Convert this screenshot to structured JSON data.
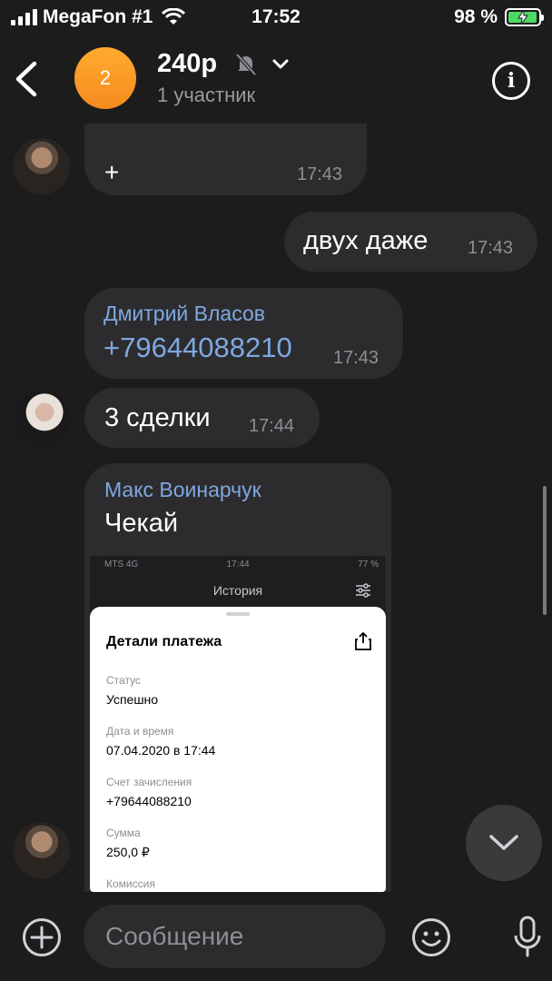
{
  "status_bar": {
    "carrier": "MegaFon #1",
    "time": "17:52",
    "battery": "98 %"
  },
  "header": {
    "avatar_letter": "2",
    "title": "240р",
    "subtitle": "1 участник",
    "info_label": "i"
  },
  "messages": [
    {
      "id": "m1",
      "sender": "",
      "text": "+",
      "time": "17:43",
      "outgoing": false
    },
    {
      "id": "m2",
      "text": "двух даже",
      "time": "17:43",
      "outgoing": true
    },
    {
      "id": "m3",
      "sender": "Дмитрий Власов",
      "text": "+79644088210",
      "time": "17:43",
      "outgoing": false
    },
    {
      "id": "m4",
      "text": "3 сделки",
      "time": "17:44",
      "outgoing": false
    },
    {
      "id": "m5",
      "sender": "Макс Воинарчук",
      "text": "Чекай",
      "outgoing": false
    }
  ],
  "embedded_screenshot": {
    "status_left": "MTS 4G",
    "status_time": "17:44",
    "status_right": "77 %",
    "screen_title": "История",
    "sheet_title": "Детали платежа",
    "fields": [
      {
        "label": "Статус",
        "value": "Успешно"
      },
      {
        "label": "Дата и время",
        "value": "07.04.2020 в 17:44"
      },
      {
        "label": "Счет зачисления",
        "value": "+79644088210"
      },
      {
        "label": "Сумма",
        "value": "250,0 ₽"
      },
      {
        "label": "Комиссия",
        "value": ""
      }
    ]
  },
  "input": {
    "placeholder": "Сообщение"
  },
  "colors": {
    "background": "#1c1c1d",
    "bubble": "#2c2c2e",
    "sender_name": "#7fa8e0",
    "group_avatar": "#f68b1f"
  }
}
